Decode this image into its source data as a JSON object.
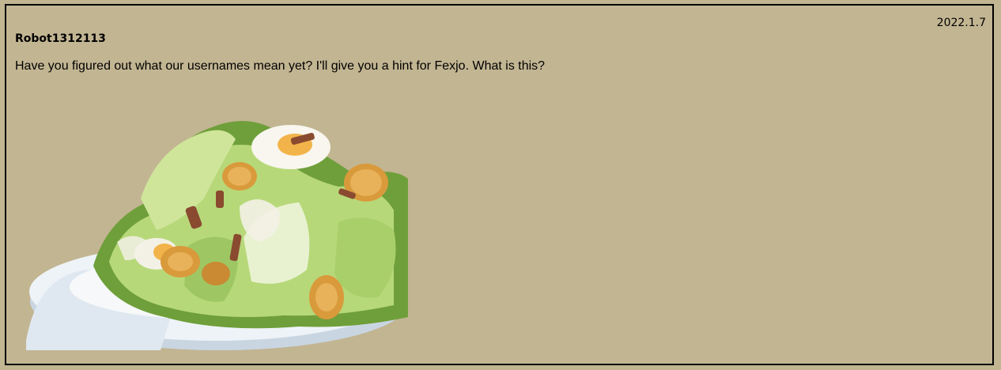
{
  "post": {
    "date": "2022.1.7",
    "username": "Robot1312113",
    "message": "Have you figured out what our usernames mean yet? I'll give you a hint for Fexjo. What is this?"
  },
  "image": {
    "subject": "caesar-salad-photo",
    "colors": {
      "plate": "#eef3f7",
      "plate_shadow": "#c9d6e2",
      "lettuce": "#b7d879",
      "lettuce_dark": "#6f9f3a",
      "crouton": "#d99a3c",
      "egg_yolk": "#f2b44a",
      "dressing": "#f3f1e6",
      "bacon": "#8a4a30"
    }
  }
}
